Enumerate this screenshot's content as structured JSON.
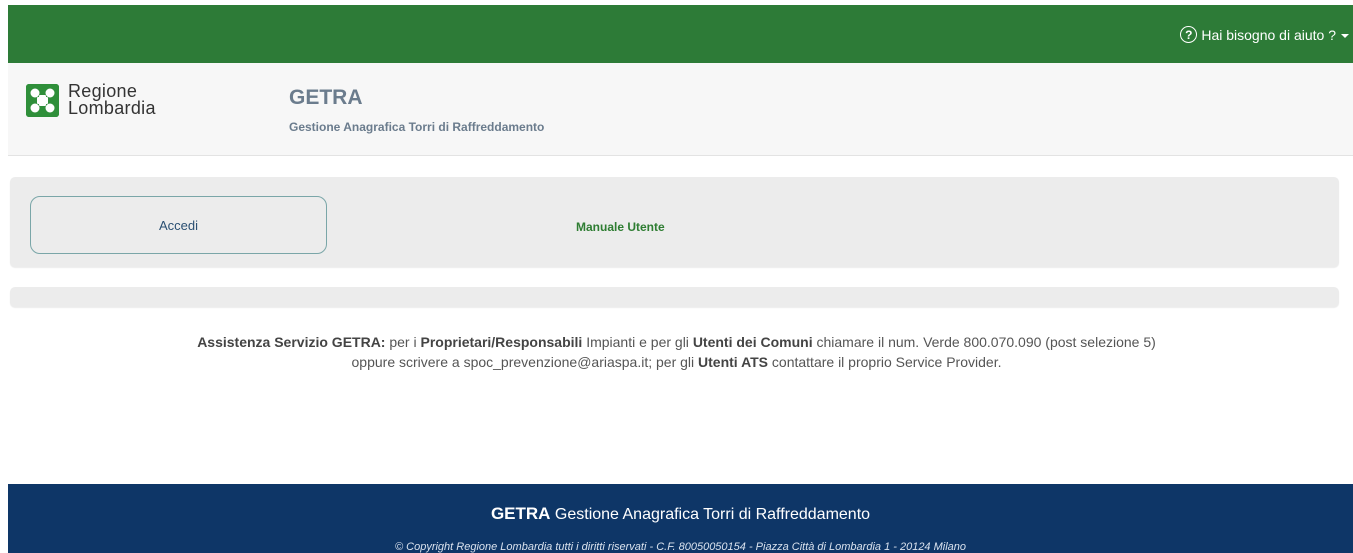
{
  "topbar": {
    "help_label": "Hai bisogno di aiuto ?",
    "help_icon": "?"
  },
  "header": {
    "logo_line1": "Regione",
    "logo_line2": "Lombardia",
    "app_title": "GETRA",
    "app_subtitle": "Gestione Anagrafica Torri di Raffreddamento"
  },
  "nav": {
    "login_label": "Accedi",
    "manual_label": "Manuale Utente"
  },
  "assistance": {
    "p1_bold": "Assistenza Servizio GETRA:",
    "p1_text1": " per i ",
    "p1_bold2": "Proprietari/Responsabili",
    "p1_text2": " Impianti e per gli ",
    "p1_bold3": "Utenti dei Comuni",
    "p1_text3": " chiamare il num. Verde 800.070.090 (post selezione 5)",
    "p2_text1": "oppure scrivere a spoc_prevenzione@ariaspa.it; per gli ",
    "p2_bold": "Utenti ATS",
    "p2_text2": " contattare il proprio Service Provider."
  },
  "footer": {
    "title_bold": "GETRA",
    "title_text": " Gestione Anagrafica Torri di Raffreddamento",
    "copyright": "© Copyright Regione Lombardia tutti i diritti riservati - C.F. 80050050154 - Piazza Città di Lombardia 1 - 20124 Milano"
  },
  "colors": {
    "topbar": "#2d7b37",
    "footer": "#0e3667",
    "accent_green": "#2e7d32"
  }
}
